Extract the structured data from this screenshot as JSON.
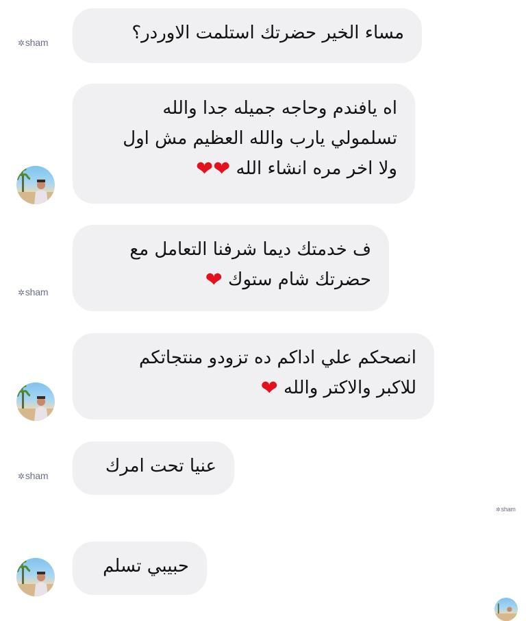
{
  "chat": {
    "messages": [
      {
        "sender": "sham",
        "lines": [
          "مساء الخير حضرتك استلمت الاوردر؟"
        ]
      },
      {
        "sender": "customer",
        "lines": [
          "اه يافندم  وحاجه جميله جدا والله",
          "تسلمولي يارب والله العظيم مش اول",
          "ولا اخر مره انشاء الله"
        ],
        "hearts": 2
      },
      {
        "sender": "sham",
        "lines": [
          "ف خدمتك ديما شرفنا التعامل مع",
          "حضرتك شام ستوك"
        ],
        "hearts": 1
      },
      {
        "sender": "customer",
        "lines": [
          "انصحكم علي اداكم ده تزودو منتجاتكم",
          "للاكبر والاكتر والله"
        ],
        "hearts": 1
      },
      {
        "sender": "sham",
        "lines": [
          "عنيا تحت امرك"
        ]
      },
      {
        "sender": "customer",
        "lines": [
          "حبيبي تسلم"
        ]
      }
    ]
  },
  "brand": {
    "logo_text": "sham",
    "logo_mark": "✲"
  },
  "colors": {
    "bubble": "#f0f0f2",
    "heart": "#e4111c",
    "logo": "#6a6f87"
  }
}
